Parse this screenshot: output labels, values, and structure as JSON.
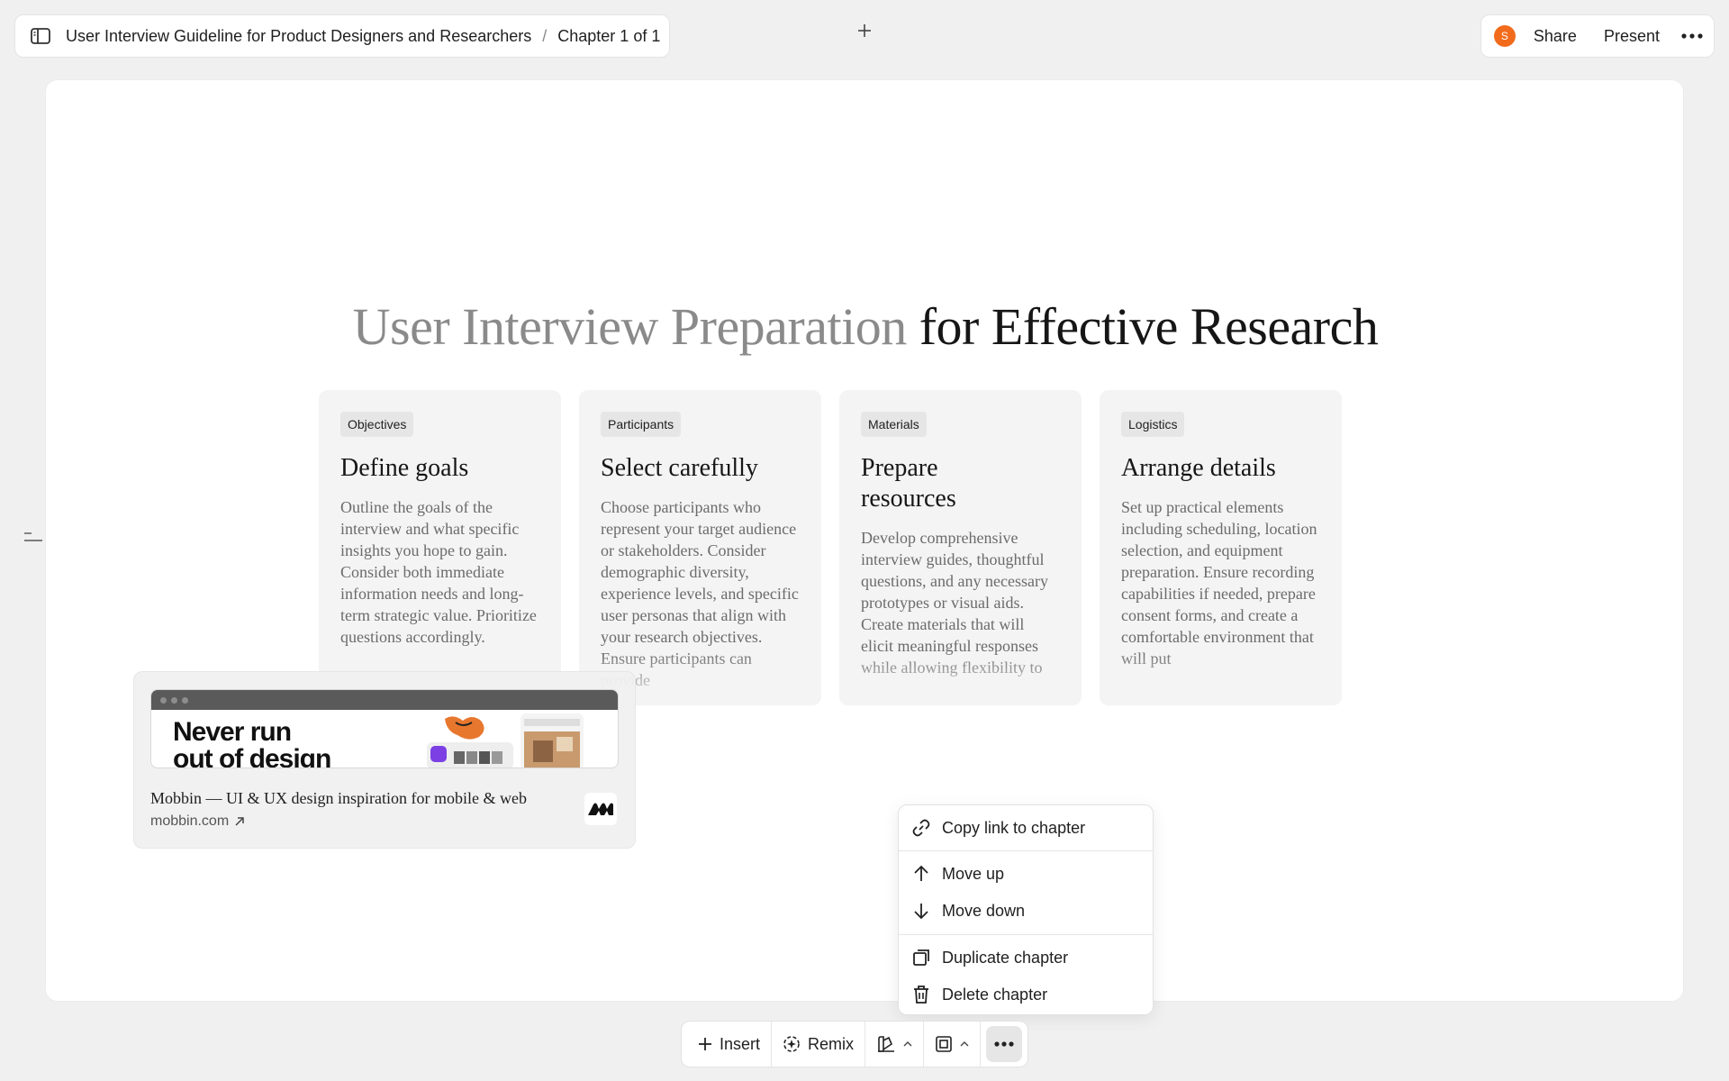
{
  "header": {
    "doc_title": "User Interview Guideline for Product Designers and Researchers",
    "separator": "/",
    "chapter": "Chapter 1 of 1",
    "avatar_initial": "S",
    "share_label": "Share",
    "present_label": "Present"
  },
  "slide": {
    "title_muted": "User Interview Preparation",
    "title_strong": " for Effective Research",
    "cards": [
      {
        "tag": "Objectives",
        "heading": "Define goals",
        "body": "Outline the goals of the interview and what specific insights you hope to gain. Consider both immediate information needs and long-term strategic value. Prioritize questions accordingly."
      },
      {
        "tag": "Participants",
        "heading": "Select carefully",
        "body": "Choose participants who represent your target audience or stakeholders. Consider demographic diversity, experience levels, and specific user personas that align with your research objectives. Ensure participants can provide"
      },
      {
        "tag": "Materials",
        "heading": "Prepare resources",
        "body": "Develop comprehensive interview guides, thoughtful questions, and any necessary prototypes or visual aids. Create materials that will elicit meaningful responses while allowing flexibility to"
      },
      {
        "tag": "Logistics",
        "heading": "Arrange details",
        "body": "Set up practical elements including scheduling, location selection, and equipment preparation. Ensure recording capabilities if needed, prepare consent forms, and create a comfortable environment that will put"
      }
    ]
  },
  "link_preview": {
    "hero_text_line1": "Never run",
    "hero_text_line2": "out of design",
    "title": "Mobbin — UI & UX design inspiration for mobile & web",
    "url": "mobbin.com"
  },
  "context_menu": {
    "items": [
      {
        "label": "Copy link to chapter",
        "icon": "link-icon"
      },
      {
        "label": "Move up",
        "icon": "arrow-up-icon"
      },
      {
        "label": "Move down",
        "icon": "arrow-down-icon"
      },
      {
        "label": "Duplicate chapter",
        "icon": "duplicate-icon"
      },
      {
        "label": "Delete chapter",
        "icon": "trash-icon"
      }
    ]
  },
  "toolbar": {
    "insert_label": "Insert",
    "remix_label": "Remix"
  },
  "colors": {
    "avatar": "#f26b1d",
    "canvas": "#ffffff",
    "background": "#f0f0f0",
    "card": "#f4f4f4"
  }
}
